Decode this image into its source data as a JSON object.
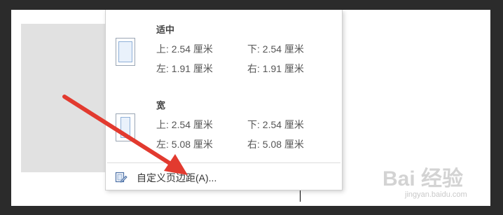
{
  "margin_presets": [
    {
      "name": "适中",
      "top": "上: 2.54 厘米",
      "bottom": "下: 2.54 厘米",
      "left": "左: 1.91 厘米",
      "right": "右: 1.91 厘米"
    },
    {
      "name": "宽",
      "top": "上: 2.54 厘米",
      "bottom": "下: 2.54 厘米",
      "left": "左: 5.08 厘米",
      "right": "右: 5.08 厘米"
    }
  ],
  "custom_margins_label": "自定义页边距(A)...",
  "watermark": {
    "logo": "Bai 经验",
    "url": "jingyan.baidu.com"
  },
  "colors": {
    "annotation_arrow": "#e23a2f",
    "frame": "#2b2b2b"
  },
  "icons": {
    "preset_thumbnail": "page-margin-thumbnail-icon",
    "custom_margins": "custom-margins-icon",
    "annotation": "red-arrow"
  }
}
